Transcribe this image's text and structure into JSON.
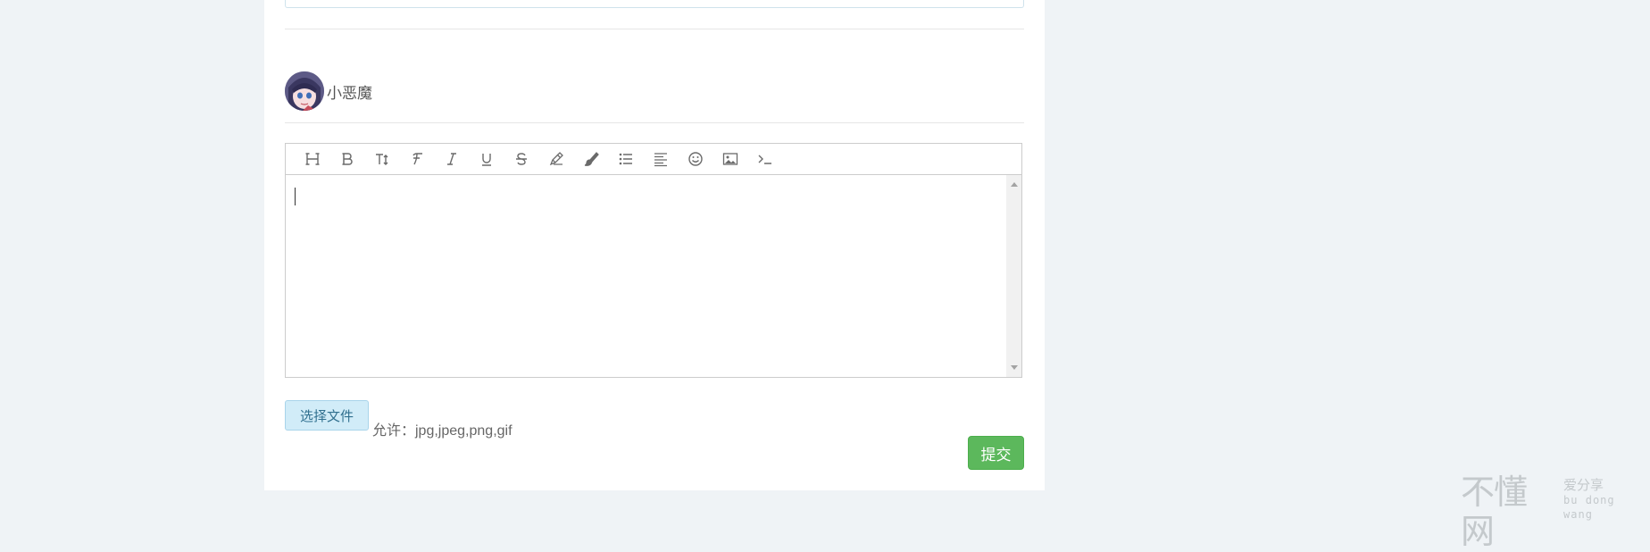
{
  "comment": {
    "username": "小恶魔",
    "toolbar": [
      {
        "name": "heading-icon",
        "glyph": "H"
      },
      {
        "name": "bold-icon",
        "glyph": "B"
      },
      {
        "name": "font-size-icon",
        "glyph": "T↕"
      },
      {
        "name": "font-family-icon",
        "glyph": "F"
      },
      {
        "name": "italic-icon",
        "glyph": "I"
      },
      {
        "name": "underline-icon",
        "glyph": "U"
      },
      {
        "name": "strikethrough-icon",
        "glyph": "S"
      },
      {
        "name": "font-color-icon",
        "glyph": "pencil"
      },
      {
        "name": "background-color-icon",
        "glyph": "brush"
      },
      {
        "name": "list-icon",
        "glyph": "list"
      },
      {
        "name": "align-icon",
        "glyph": "align"
      },
      {
        "name": "emoticon-icon",
        "glyph": "☺"
      },
      {
        "name": "image-icon",
        "glyph": "image"
      },
      {
        "name": "code-icon",
        "glyph": ">_"
      }
    ],
    "editor_value": "",
    "choose_file_label": "选择文件",
    "allow_text": "允许：jpg,jpeg,png,gif",
    "submit_label": "提交"
  },
  "watermark": {
    "main": "不懂网",
    "sub": "爱分享",
    "pinyin": "bu dong wang"
  },
  "colors": {
    "background": "#eff3f6",
    "submit": "#5cb85c",
    "file_button": "#d1ecf8"
  }
}
